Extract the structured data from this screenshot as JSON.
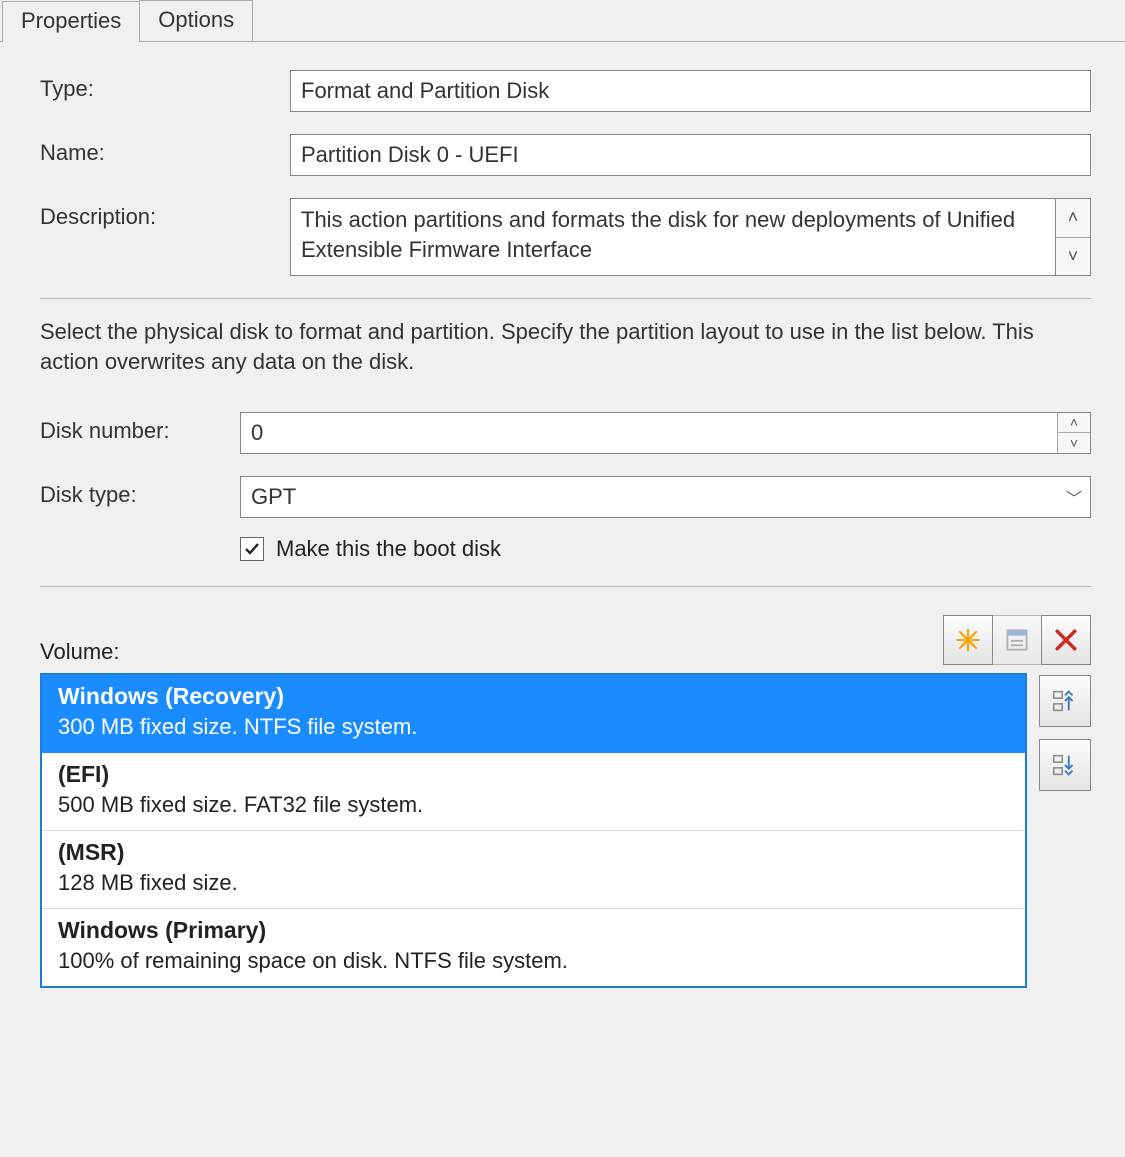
{
  "tabs": {
    "properties": "Properties",
    "options": "Options"
  },
  "form": {
    "type_label": "Type:",
    "type_value": "Format and Partition Disk",
    "name_label": "Name:",
    "name_value": "Partition Disk 0 - UEFI",
    "description_label": "Description:",
    "description_value": "This action partitions and formats the disk for new deployments of Unified Extensible Firmware Interface"
  },
  "instruction": "Select the physical disk to format and partition. Specify the partition layout to use in the list below. This action overwrites any data on the disk.",
  "disk": {
    "number_label": "Disk number:",
    "number_value": "0",
    "type_label": "Disk type:",
    "type_value": "GPT",
    "boot_label": "Make this the boot disk",
    "boot_checked": true
  },
  "volume": {
    "label": "Volume:",
    "items": [
      {
        "title": "Windows (Recovery)",
        "desc": "300 MB fixed size. NTFS file system.",
        "selected": true
      },
      {
        "title": "(EFI)",
        "desc": "500 MB fixed size. FAT32 file system.",
        "selected": false
      },
      {
        "title": "(MSR)",
        "desc": "128 MB fixed size.",
        "selected": false
      },
      {
        "title": "Windows (Primary)",
        "desc": "100% of remaining space on disk. NTFS file system.",
        "selected": false
      }
    ]
  },
  "icons": {
    "new": "new-icon",
    "props": "properties-icon",
    "delete": "delete-icon",
    "moveup": "move-up-icon",
    "movedown": "move-down-icon"
  }
}
